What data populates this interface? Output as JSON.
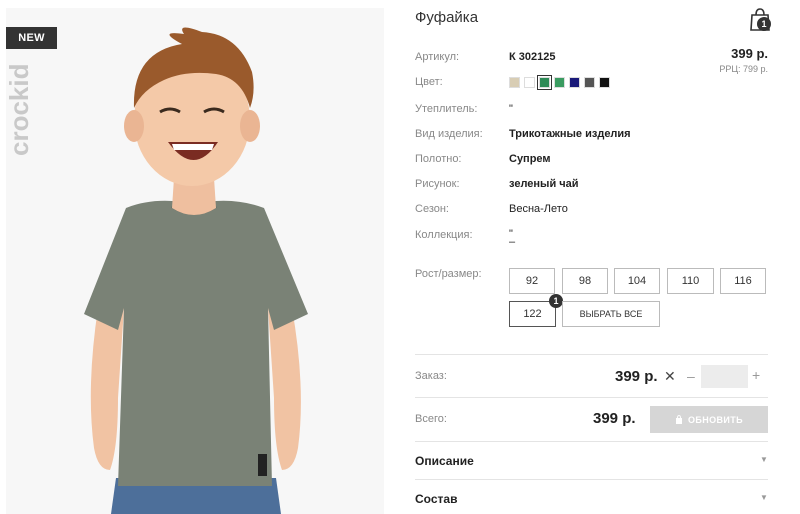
{
  "badge": {
    "new": "NEW"
  },
  "brand": {
    "logo_text": "crockid"
  },
  "product": {
    "title": "Фуфайка",
    "price": "399 р.",
    "rrp": "РРЦ: 799 р."
  },
  "cart": {
    "count": "1",
    "icon": "shopping-bag-icon"
  },
  "details": {
    "article_label": "Артикул:",
    "article_value": "К 302125",
    "color_label": "Цвет:",
    "insulation_label": "Утеплитель:",
    "insulation_value": "\"",
    "type_label": "Вид изделия:",
    "type_value": "Трикотажные изделия",
    "fabric_label": "Полотно:",
    "fabric_value": "Супрем",
    "pattern_label": "Рисунок:",
    "pattern_value": "зеленый чай",
    "season_label": "Сезон:",
    "season_value": "Весна-Лето",
    "collection_label": "Коллекция:",
    "collection_value_1": "\"",
    "collection_value_2": "–"
  },
  "colors": [
    "#d8cdb4",
    "#ffffff",
    "#2e8b57",
    "#3a9b60",
    "#1a1a7a",
    "#555555",
    "#111111"
  ],
  "selected_color_index": 2,
  "sizes": {
    "label": "Рост/размер:",
    "options": [
      "92",
      "98",
      "104",
      "110",
      "116",
      "122"
    ],
    "selected": "122",
    "selected_count": "1",
    "select_all": "ВЫБРАТЬ ВСЕ"
  },
  "order": {
    "label": "Заказ:",
    "price": "399 р.",
    "quantity": ""
  },
  "total": {
    "label": "Всего:",
    "price": "399 р.",
    "update_button": "ОБНОВИТЬ"
  },
  "accordion": {
    "description": "Описание",
    "composition": "Состав"
  }
}
